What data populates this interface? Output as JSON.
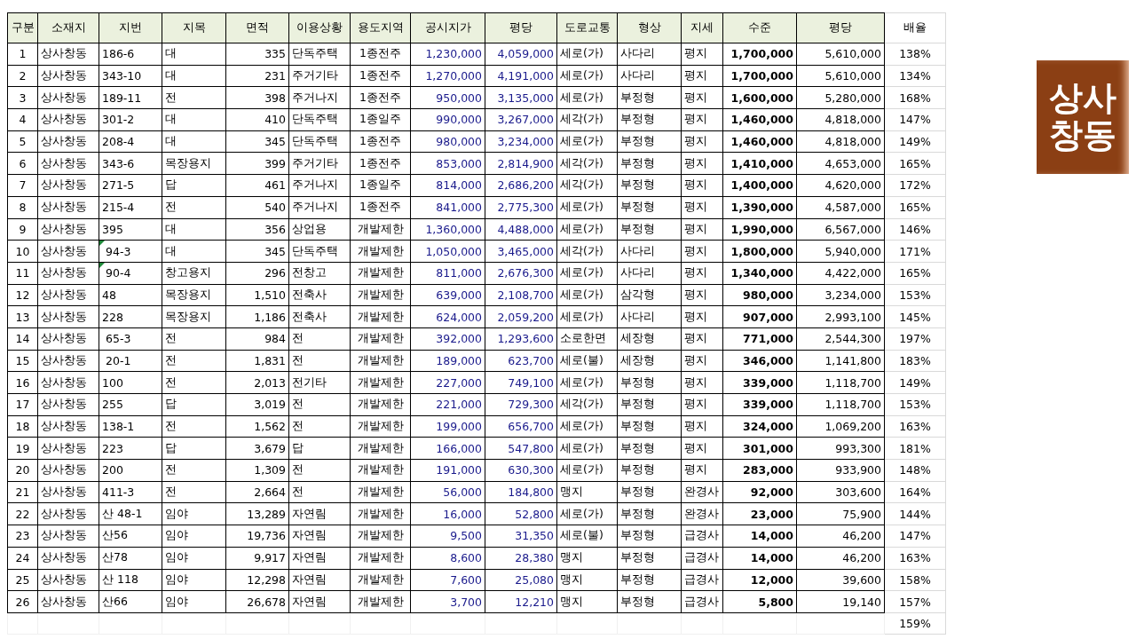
{
  "table": {
    "columns": [
      "구분",
      "소재지",
      "지번",
      "지목",
      "면적",
      "이용상황",
      "용도지역",
      "공시지가",
      "평당",
      "도로교통",
      "형상",
      "지세",
      "수준",
      "평당",
      "배율"
    ],
    "rows": [
      {
        "marked": false,
        "cells": [
          "1",
          "상사창동",
          "186-6",
          "대",
          "335",
          "단독주택",
          "1종전주",
          "1,230,000",
          "4,059,000",
          "세로(가)",
          "사다리",
          "평지",
          "1,700,000",
          "5,610,000",
          "138%"
        ]
      },
      {
        "marked": false,
        "cells": [
          "2",
          "상사창동",
          "343-10",
          "대",
          "231",
          "주거기타",
          "1종전주",
          "1,270,000",
          "4,191,000",
          "세로(가)",
          "사다리",
          "평지",
          "1,700,000",
          "5,610,000",
          "134%"
        ]
      },
      {
        "marked": false,
        "cells": [
          "3",
          "상사창동",
          "189-11",
          "전",
          "398",
          "주거나지",
          "1종전주",
          "950,000",
          "3,135,000",
          "세로(가)",
          "부정형",
          "평지",
          "1,600,000",
          "5,280,000",
          "168%"
        ]
      },
      {
        "marked": false,
        "cells": [
          "4",
          "상사창동",
          "301-2",
          "대",
          "410",
          "단독주택",
          "1종일주",
          "990,000",
          "3,267,000",
          "세각(가)",
          "부정형",
          "평지",
          "1,460,000",
          "4,818,000",
          "147%"
        ]
      },
      {
        "marked": false,
        "cells": [
          "5",
          "상사창동",
          "208-4",
          "대",
          "345",
          "단독주택",
          "1종전주",
          "980,000",
          "3,234,000",
          "세로(가)",
          "부정형",
          "평지",
          "1,460,000",
          "4,818,000",
          "149%"
        ]
      },
      {
        "marked": false,
        "cells": [
          "6",
          "상사창동",
          "343-6",
          "목장용지",
          "399",
          "주거기타",
          "1종전주",
          "853,000",
          "2,814,900",
          "세각(가)",
          "부정형",
          "평지",
          "1,410,000",
          "4,653,000",
          "165%"
        ]
      },
      {
        "marked": false,
        "cells": [
          "7",
          "상사창동",
          "271-5",
          "답",
          "461",
          "주거나지",
          "1종일주",
          "814,000",
          "2,686,200",
          "세각(가)",
          "부정형",
          "평지",
          "1,400,000",
          "4,620,000",
          "172%"
        ]
      },
      {
        "marked": false,
        "cells": [
          "8",
          "상사창동",
          "215-4",
          "전",
          "540",
          "주거나지",
          "1종전주",
          "841,000",
          "2,775,300",
          "세로(가)",
          "부정형",
          "평지",
          "1,390,000",
          "4,587,000",
          "165%"
        ]
      },
      {
        "marked": false,
        "cells": [
          "9",
          "상사창동",
          "395",
          "대",
          "356",
          "상업용",
          "개발제한",
          "1,360,000",
          "4,488,000",
          "세로(가)",
          "부정형",
          "평지",
          "1,990,000",
          "6,567,000",
          "146%"
        ]
      },
      {
        "marked": true,
        "cells": [
          "10",
          "상사창동",
          " 94-3",
          "대",
          "345",
          "단독주택",
          "개발제한",
          "1,050,000",
          "3,465,000",
          "세각(가)",
          "사다리",
          "평지",
          "1,800,000",
          "5,940,000",
          "171%"
        ]
      },
      {
        "marked": true,
        "cells": [
          "11",
          "상사창동",
          " 90-4",
          "창고용지",
          "296",
          "전창고",
          "개발제한",
          "811,000",
          "2,676,300",
          "세로(가)",
          "사다리",
          "평지",
          "1,340,000",
          "4,422,000",
          "165%"
        ]
      },
      {
        "marked": false,
        "cells": [
          "12",
          "상사창동",
          "48",
          "목장용지",
          "1,510",
          "전축사",
          "개발제한",
          "639,000",
          "2,108,700",
          "세로(가)",
          "삼각형",
          "평지",
          "980,000",
          "3,234,000",
          "153%"
        ]
      },
      {
        "marked": false,
        "cells": [
          "13",
          "상사창동",
          "228",
          "목장용지",
          "1,186",
          "전축사",
          "개발제한",
          "624,000",
          "2,059,200",
          "세로(가)",
          "사다리",
          "평지",
          "907,000",
          "2,993,100",
          "145%"
        ]
      },
      {
        "marked": false,
        "cells": [
          "14",
          "상사창동",
          " 65-3",
          "전",
          "984",
          "전",
          "개발제한",
          "392,000",
          "1,293,600",
          "소로한면",
          "세장형",
          "평지",
          "771,000",
          "2,544,300",
          "197%"
        ]
      },
      {
        "marked": false,
        "cells": [
          "15",
          "상사창동",
          " 20-1",
          "전",
          "1,831",
          "전",
          "개발제한",
          "189,000",
          "623,700",
          "세로(불)",
          "세장형",
          "평지",
          "346,000",
          "1,141,800",
          "183%"
        ]
      },
      {
        "marked": false,
        "cells": [
          "16",
          "상사창동",
          "100",
          "전",
          "2,013",
          "전기타",
          "개발제한",
          "227,000",
          "749,100",
          "세로(가)",
          "부정형",
          "평지",
          "339,000",
          "1,118,700",
          "149%"
        ]
      },
      {
        "marked": false,
        "cells": [
          "17",
          "상사창동",
          "255",
          "답",
          "3,019",
          "전",
          "개발제한",
          "221,000",
          "729,300",
          "세각(가)",
          "부정형",
          "평지",
          "339,000",
          "1,118,700",
          "153%"
        ]
      },
      {
        "marked": false,
        "cells": [
          "18",
          "상사창동",
          "138-1",
          "전",
          "1,562",
          "전",
          "개발제한",
          "199,000",
          "656,700",
          "세로(가)",
          "부정형",
          "평지",
          "324,000",
          "1,069,200",
          "163%"
        ]
      },
      {
        "marked": false,
        "cells": [
          "19",
          "상사창동",
          "223",
          "답",
          "3,679",
          "답",
          "개발제한",
          "166,000",
          "547,800",
          "세로(가)",
          "부정형",
          "평지",
          "301,000",
          "993,300",
          "181%"
        ]
      },
      {
        "marked": false,
        "cells": [
          "20",
          "상사창동",
          "200",
          "전",
          "1,309",
          "전",
          "개발제한",
          "191,000",
          "630,300",
          "세로(가)",
          "부정형",
          "평지",
          "283,000",
          "933,900",
          "148%"
        ]
      },
      {
        "marked": false,
        "cells": [
          "21",
          "상사창동",
          "411-3",
          "전",
          "2,664",
          "전",
          "개발제한",
          "56,000",
          "184,800",
          "맹지",
          "부정형",
          "완경사",
          "92,000",
          "303,600",
          "164%"
        ]
      },
      {
        "marked": false,
        "cells": [
          "22",
          "상사창동",
          "산 48-1",
          "임야",
          "13,289",
          "자연림",
          "개발제한",
          "16,000",
          "52,800",
          "세로(가)",
          "부정형",
          "완경사",
          "23,000",
          "75,900",
          "144%"
        ]
      },
      {
        "marked": false,
        "cells": [
          "23",
          "상사창동",
          "산56",
          "임야",
          "19,736",
          "자연림",
          "개발제한",
          "9,500",
          "31,350",
          "세로(불)",
          "부정형",
          "급경사",
          "14,000",
          "46,200",
          "147%"
        ]
      },
      {
        "marked": false,
        "cells": [
          "24",
          "상사창동",
          "산78",
          "임야",
          "9,917",
          "자연림",
          "개발제한",
          "8,600",
          "28,380",
          "맹지",
          "부정형",
          "급경사",
          "14,000",
          "46,200",
          "163%"
        ]
      },
      {
        "marked": false,
        "cells": [
          "25",
          "상사창동",
          "산 118",
          "임야",
          "12,298",
          "자연림",
          "개발제한",
          "7,600",
          "25,080",
          "맹지",
          "부정형",
          "급경사",
          "12,000",
          "39,600",
          "158%"
        ]
      },
      {
        "marked": false,
        "cells": [
          "26",
          "상사창동",
          "산66",
          "임야",
          "26,678",
          "자연림",
          "개발제한",
          "3,700",
          "12,210",
          "맹지",
          "부정형",
          "급경사",
          "5,800",
          "19,140",
          "157%"
        ]
      }
    ],
    "average": "159%"
  },
  "tag": {
    "lines": [
      "상사",
      "창동"
    ]
  }
}
